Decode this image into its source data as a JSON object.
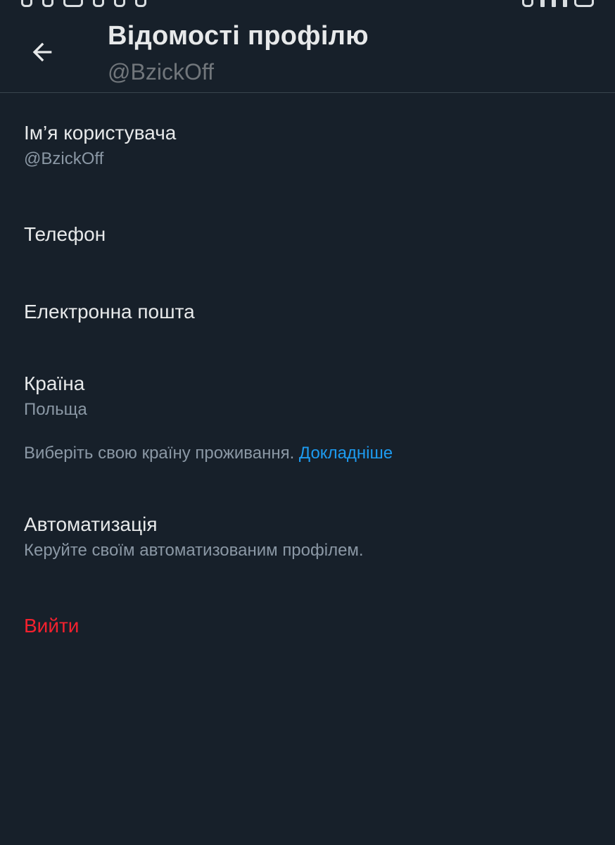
{
  "header": {
    "back_icon": "arrow-left-icon",
    "title": "Відомості профілю",
    "subtitle": "@BzickOff"
  },
  "items": [
    {
      "label": "Ім’я користувача",
      "value": "@BzickOff"
    },
    {
      "label": "Телефон"
    },
    {
      "label": "Електронна пошта"
    },
    {
      "label": "Країна",
      "value": "Польща"
    },
    {
      "label": "Автоматизація",
      "value": "Керуйте своїм автоматизованим профілем."
    }
  ],
  "country_note": {
    "text": "Виберіть свою країну проживання.",
    "link": "Докладніше"
  },
  "logout": {
    "label": "Вийти"
  },
  "colors": {
    "background": "#17202a",
    "primary_text": "#e7e9ea",
    "secondary_text": "#8b98a5",
    "link": "#1d9bf0",
    "danger": "#f4212e"
  }
}
